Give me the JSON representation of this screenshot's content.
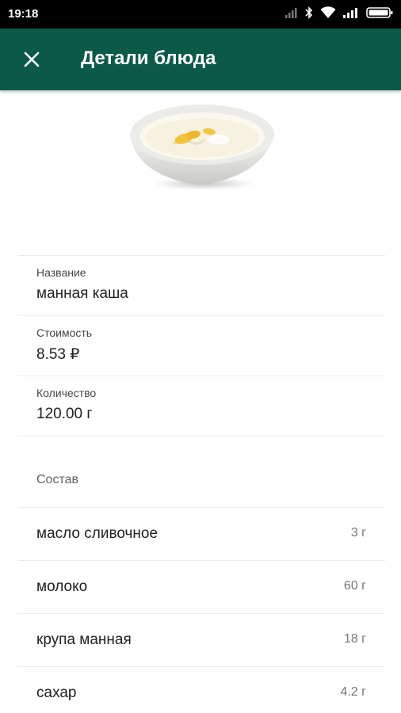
{
  "status_bar": {
    "time": "19:18",
    "icons": [
      "signal-bars-icon",
      "bluetooth-icon",
      "wifi-icon",
      "signal-bars-icon",
      "battery-icon"
    ]
  },
  "app_bar": {
    "title": "Детали блюда",
    "close_icon": "close-icon",
    "color": "#0b5a47"
  },
  "dish": {
    "image": "porridge-bowl-image"
  },
  "details": {
    "name_label": "Название",
    "name_value": "манная каша",
    "cost_label": "Стоимость",
    "cost_value": "8.53 ₽",
    "quantity_label": "Количество",
    "quantity_value": "120.00 г"
  },
  "composition": {
    "title": "Состав",
    "items": [
      {
        "name": "масло сливочное",
        "amount": "3 г"
      },
      {
        "name": "молоко",
        "amount": "60 г"
      },
      {
        "name": "крупа манная",
        "amount": "18 г"
      },
      {
        "name": "сахар",
        "amount": "4.2 г"
      }
    ]
  }
}
